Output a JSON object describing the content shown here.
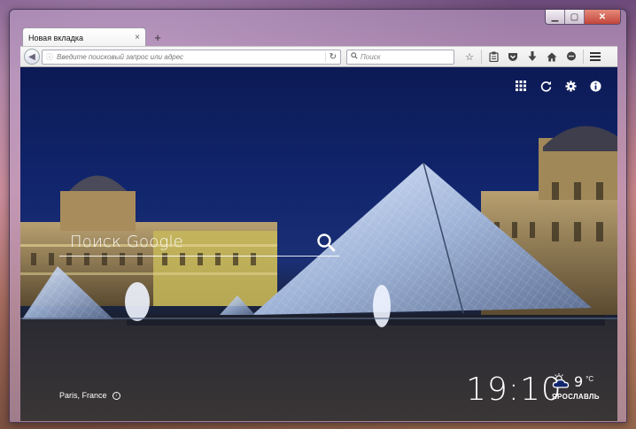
{
  "window": {
    "controls": {
      "minimize": "▁",
      "maximize": "▢",
      "close": "✕"
    }
  },
  "tabs": [
    {
      "label": "Новая вкладка",
      "close": "×"
    }
  ],
  "new_tab_label": "+",
  "navbar": {
    "back": "◀",
    "url_placeholder": "Введите поисковый запрос или адрес",
    "reload": "↻",
    "search_placeholder": "Поиск",
    "icons": [
      "star-icon",
      "clipboard-icon",
      "pocket-icon",
      "download-icon",
      "home-icon",
      "chat-icon",
      "menu-icon"
    ]
  },
  "newtab": {
    "search_placeholder": "Поиск Google",
    "location": "Paris, France",
    "time": "19:10",
    "weather": {
      "temperature": "9",
      "unit": "°C",
      "city": "ЯРОСЛАВЛЬ"
    },
    "top_icons": [
      "apps-icon",
      "refresh-icon",
      "gear-icon",
      "info-icon"
    ]
  },
  "colors": {
    "sky": "#12266e",
    "window_frame": "#bda6c6",
    "close_button": "#c94a3c"
  }
}
